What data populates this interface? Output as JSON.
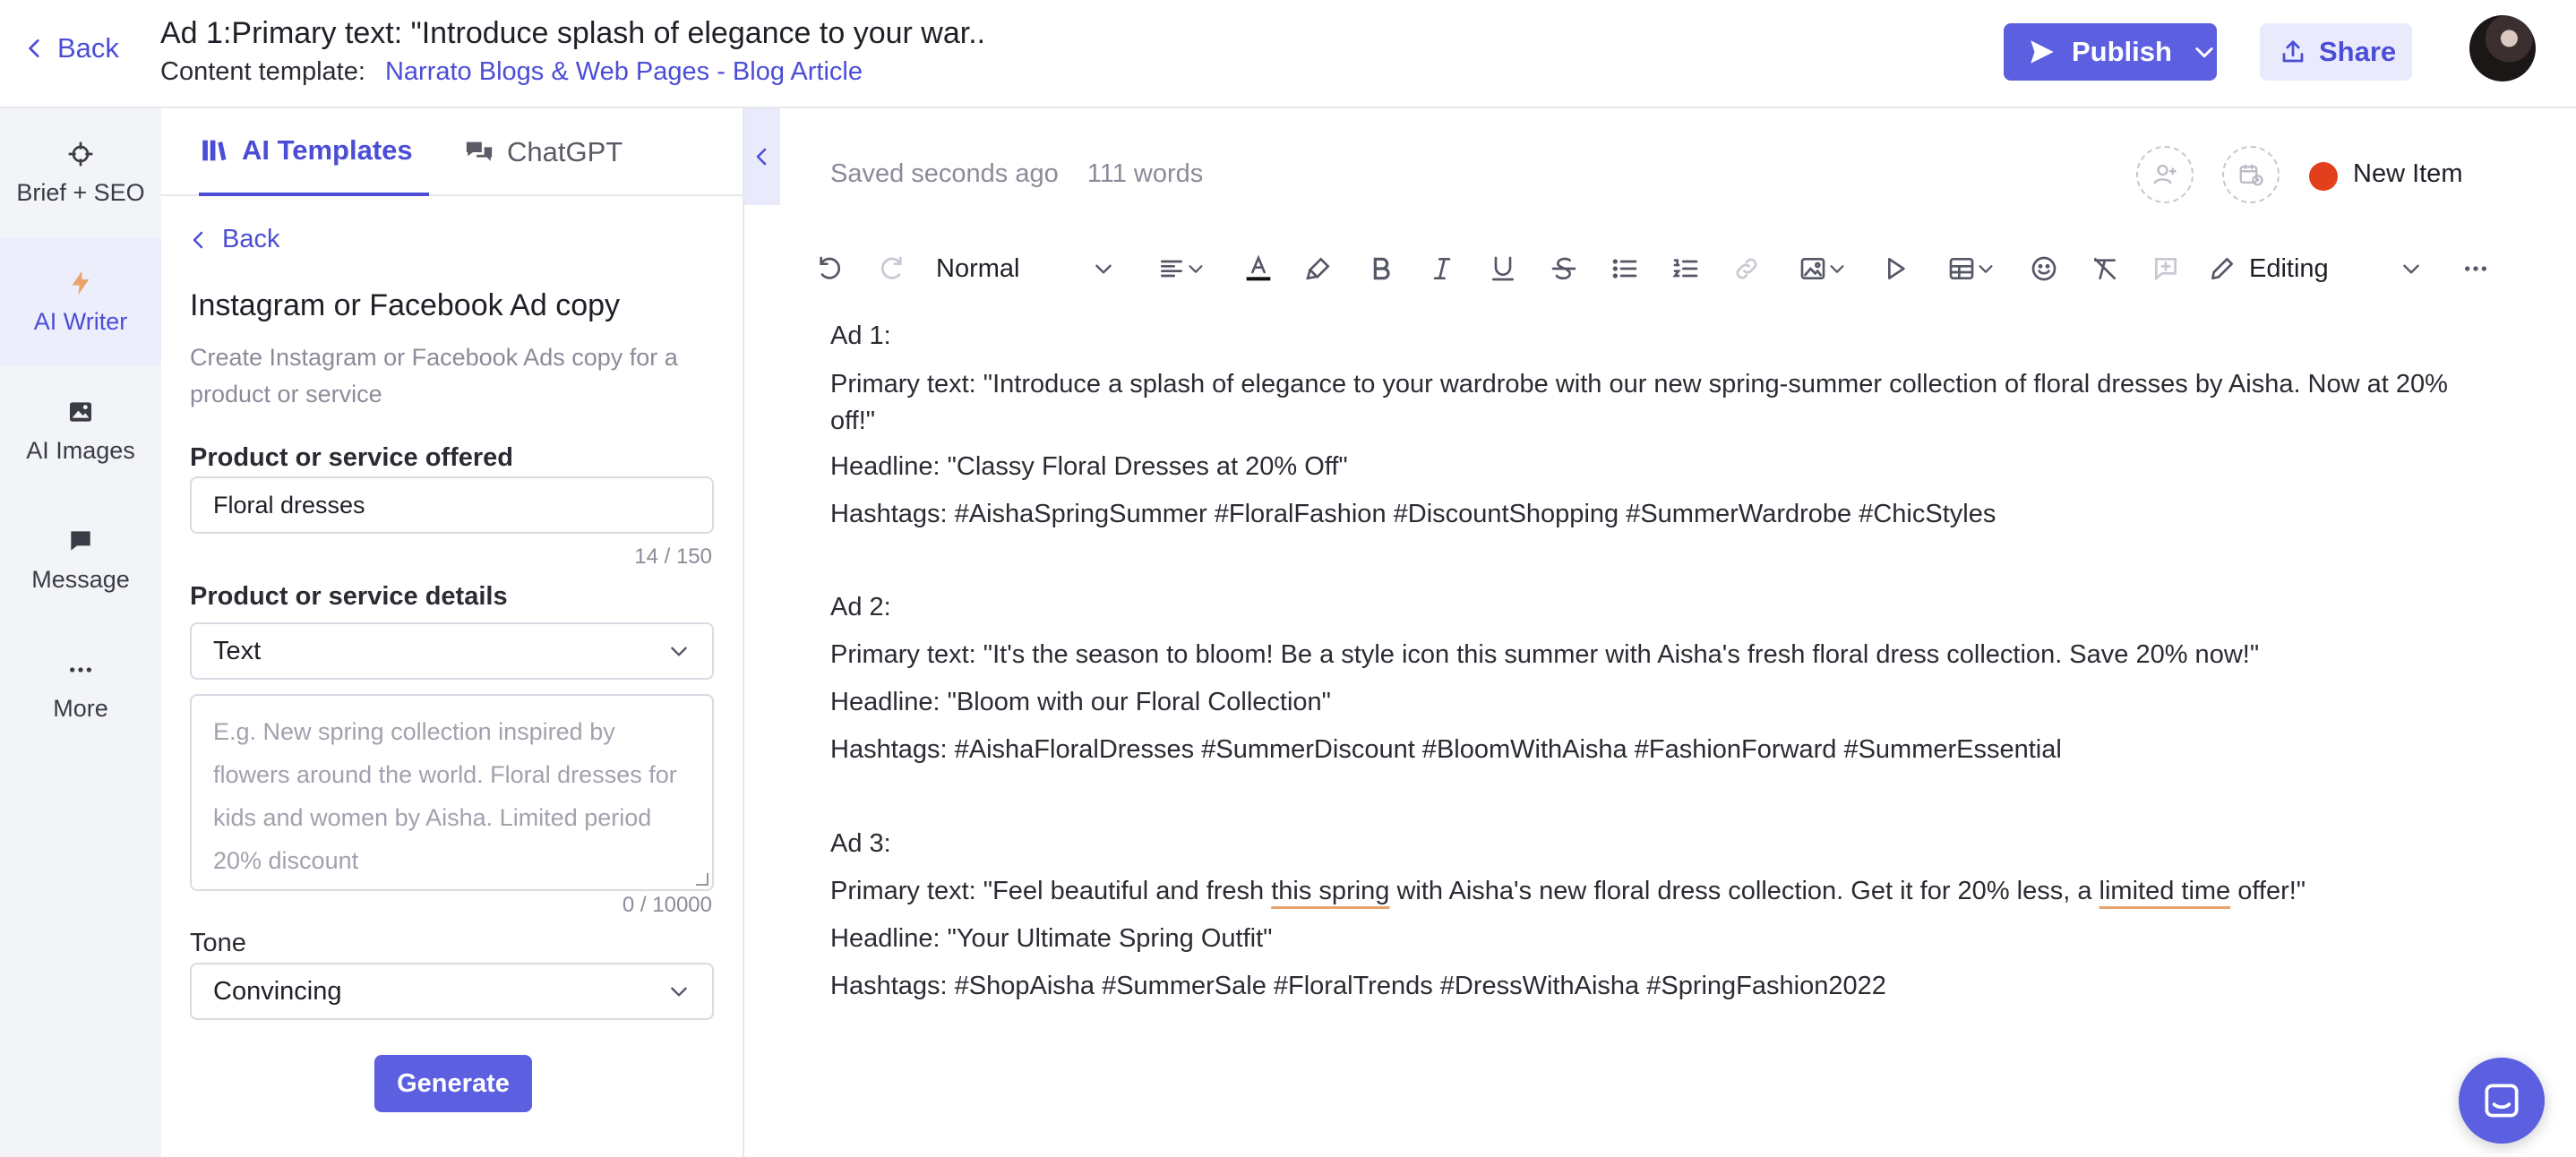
{
  "header": {
    "back_label": "Back",
    "doc_title": "Ad 1:Primary text: \"Introduce splash of elegance to your war..",
    "template_label": "Content template:",
    "template_name": "Narrato Blogs & Web Pages - Blog Article",
    "publish_label": "Publish",
    "share_label": "Share"
  },
  "rail": {
    "items": [
      {
        "label": "Brief + SEO",
        "icon": "crosshair-icon"
      },
      {
        "label": "AI Writer",
        "icon": "lightning-icon"
      },
      {
        "label": "AI Images",
        "icon": "image-icon"
      },
      {
        "label": "Message",
        "icon": "chat-icon"
      },
      {
        "label": "More",
        "icon": "dots-icon"
      }
    ]
  },
  "panel": {
    "tabs": [
      {
        "label": "AI Templates",
        "icon": "template-icon",
        "active": true
      },
      {
        "label": "ChatGPT",
        "icon": "chat-bubbles-icon",
        "active": false
      }
    ],
    "back_label": "Back",
    "title": "Instagram or Facebook Ad copy",
    "description": "Create Instagram or Facebook Ads copy for a product or service",
    "product_label": "Product or service offered",
    "product_value": "Floral dresses",
    "product_counter": "14 / 150",
    "details_label": "Product or service details",
    "details_select": "Text",
    "details_placeholder": "E.g. New spring collection inspired by flowers around the world. Floral dresses for kids and women by Aisha. Limited period 20% discount",
    "details_counter": "0 / 10000",
    "tone_label": "Tone",
    "tone_value": "Convincing",
    "generate_label": "Generate"
  },
  "editor": {
    "saved_status": "Saved seconds ago",
    "word_count": "111 words",
    "item_status": "New Item",
    "status_color": "#e2401c",
    "toolbar": {
      "paragraph_style": "Normal",
      "mode_label": "Editing"
    },
    "ads": [
      {
        "heading": "Ad 1:",
        "primary": "Primary text: \"Introduce a splash of elegance to your wardrobe with our new spring-summer collection of floral dresses by Aisha. Now at 20% off!\"",
        "headline": "Headline: \"Classy Floral Dresses at 20% Off\"",
        "hashtags": "Hashtags: #AishaSpringSummer #FloralFashion #DiscountShopping #SummerWardrobe #ChicStyles"
      },
      {
        "heading": "Ad 2:",
        "primary": "Primary text: \"It's the season to bloom! Be a style icon this summer with Aisha's fresh floral dress collection. Save 20% now!\"",
        "headline": "Headline: \"Bloom with our Floral Collection\"",
        "hashtags": "Hashtags: #AishaFloralDresses #SummerDiscount #BloomWithAisha #FashionForward #SummerEssential"
      },
      {
        "heading": "Ad 3:",
        "primary_parts": [
          "Primary text: \"Feel beautiful and fresh ",
          "this spring",
          " with Aisha's new floral dress collection. Get it for 20% less, a ",
          "limited time",
          " offer!\""
        ],
        "headline": "Headline: \"Your Ultimate Spring Outfit\"",
        "hashtags": "Hashtags: #ShopAisha #SummerSale #FloralTrends #DressWithAisha #SpringFashion2022"
      }
    ]
  },
  "colors": {
    "accent": "#5b5fe0",
    "link": "#4b4dd6",
    "rail_bg": "#f3f4f8"
  }
}
